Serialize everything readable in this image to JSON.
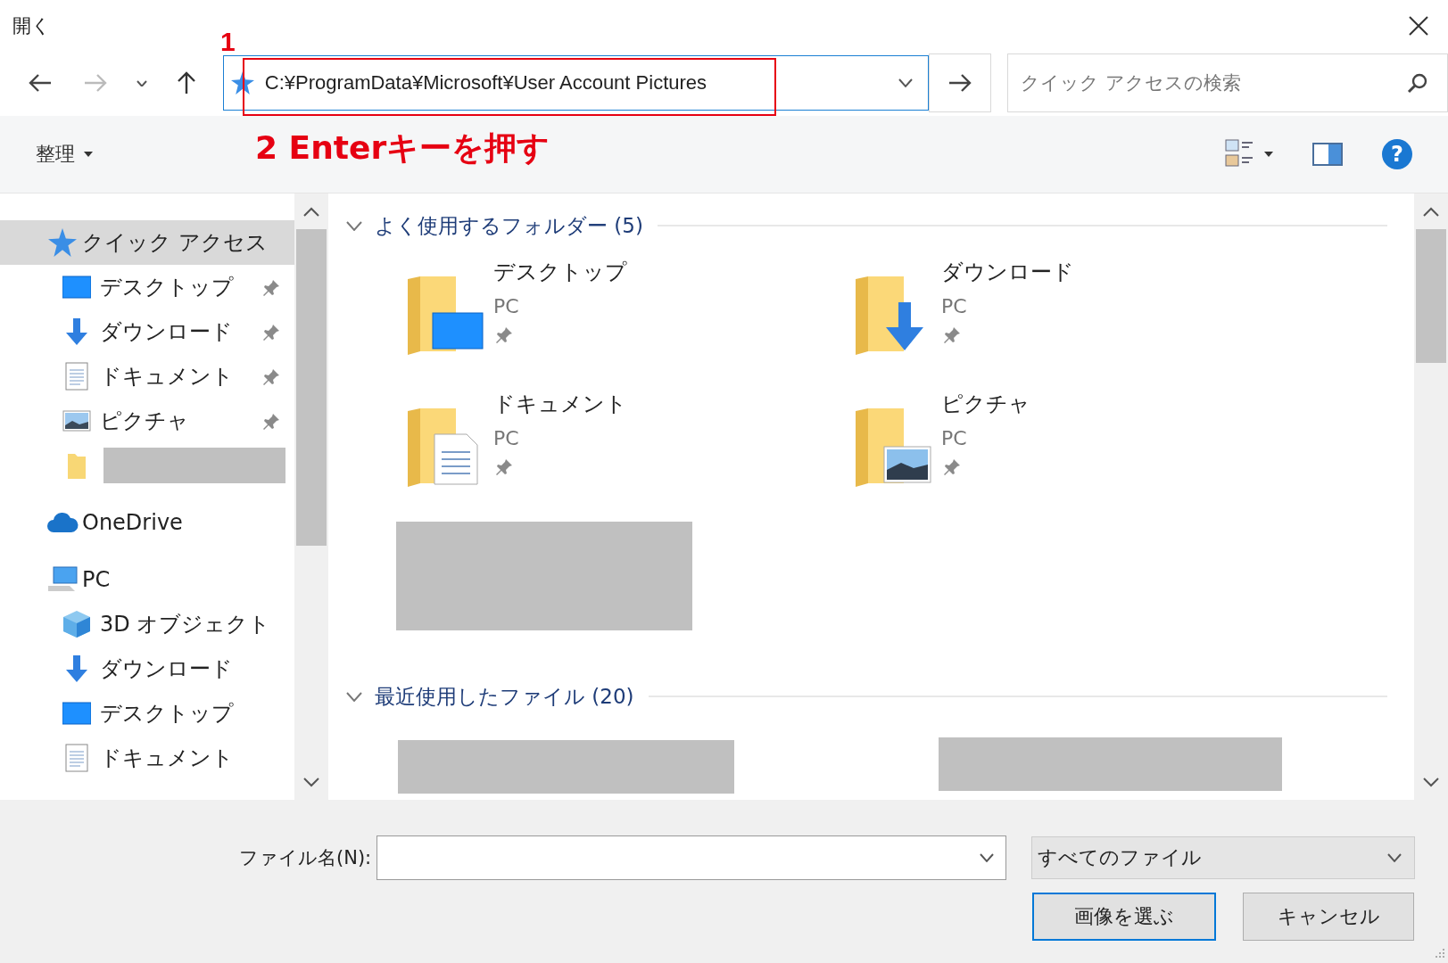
{
  "window": {
    "title": "開く"
  },
  "address_bar": {
    "value": "C:¥ProgramData¥Microsoft¥User Account Pictures"
  },
  "search": {
    "placeholder": "クイック アクセスの検索"
  },
  "annotations": [
    {
      "kind": "step-number",
      "text": "1"
    },
    {
      "kind": "instruction",
      "text": "2 Enterキーを押す"
    }
  ],
  "toolbar": {
    "organize": "整理",
    "help": "?"
  },
  "sidebar": {
    "items": [
      {
        "kind": "quick",
        "label": "クイック アクセス",
        "selected": true,
        "children": [
          {
            "kind": "desktop",
            "label": "デスクトップ",
            "pinned": true,
            "selected": false
          },
          {
            "kind": "downloads",
            "label": "ダウンロード",
            "pinned": true,
            "selected": false
          },
          {
            "kind": "documents",
            "label": "ドキュメント",
            "pinned": true,
            "selected": false
          },
          {
            "kind": "pictures",
            "label": "ピクチャ",
            "pinned": true,
            "selected": false
          },
          {
            "kind": "redacted",
            "selected": false
          }
        ]
      },
      {
        "kind": "cloud",
        "label": "OneDrive",
        "selected": false
      },
      {
        "kind": "pc",
        "label": "PC",
        "selected": false,
        "children": [
          {
            "kind": "objects3d",
            "label": "3D オブジェクト",
            "selected": false
          },
          {
            "kind": "downloads",
            "label": "ダウンロード",
            "selected": false
          },
          {
            "kind": "desktop",
            "label": "デスクトップ",
            "selected": false
          },
          {
            "kind": "documents",
            "label": "ドキュメント",
            "selected": false
          }
        ]
      }
    ]
  },
  "groups": [
    {
      "title": "よく使用するフォルダー (5)",
      "expanded": true,
      "items": [
        {
          "kind": "desktop",
          "name": "デスクトップ",
          "location": "PC",
          "pinned": true
        },
        {
          "kind": "downloads",
          "name": "ダウンロード",
          "location": "PC",
          "pinned": true
        },
        {
          "kind": "documents",
          "name": "ドキュメント",
          "location": "PC",
          "pinned": true
        },
        {
          "kind": "pictures",
          "name": "ピクチャ",
          "location": "PC",
          "pinned": true
        },
        {
          "kind": "redacted"
        }
      ]
    },
    {
      "title": "最近使用したファイル (20)",
      "expanded": true,
      "items": [
        {
          "kind": "redacted"
        },
        {
          "kind": "redacted"
        }
      ]
    }
  ],
  "bottom": {
    "filename_label": "ファイル名(N):",
    "file_type": "すべてのファイル",
    "buttons": [
      {
        "label": "画像を選ぶ",
        "default": true
      },
      {
        "label": "キャンセル",
        "default": false
      }
    ]
  }
}
